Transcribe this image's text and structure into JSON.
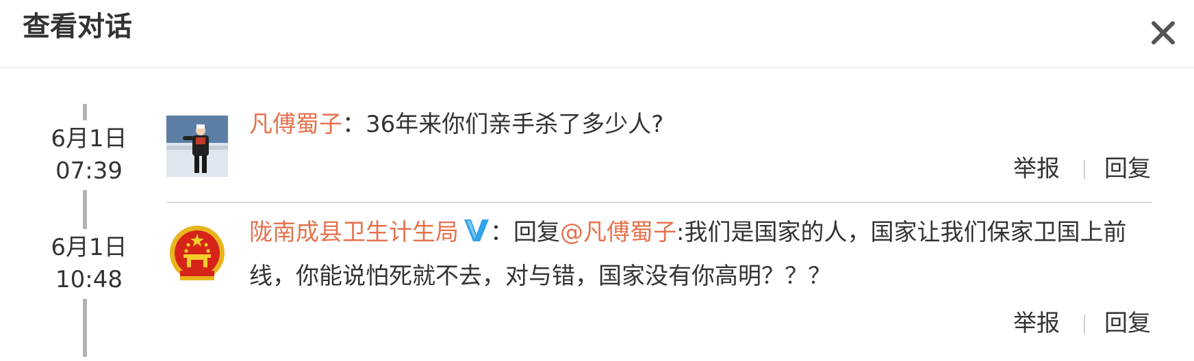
{
  "dialog": {
    "title": "查看对话",
    "close_icon": "close-icon"
  },
  "conversation": [
    {
      "date": "6月1日",
      "time": "07:39",
      "avatar": "user-photo-avatar",
      "user": "凡傅蜀子",
      "colon": "：",
      "text": "36年来你们亲手杀了多少人?",
      "actions": {
        "report": "举报",
        "reply": "回复"
      }
    },
    {
      "date": "6月1日",
      "time": "10:48",
      "avatar": "national-emblem-avatar",
      "user": "陇南成县卫生计生局",
      "verified_icon": "verified-v-icon",
      "colon": "：",
      "reply_prefix": "回复",
      "mention": "@凡傅蜀子",
      "text": ":我们是国家的人，国家让我们保家卫国上前线，你能说怕死就不去，对与错，国家没有你高明？？？",
      "actions": {
        "report": "举报",
        "reply": "回复"
      }
    }
  ],
  "colors": {
    "username": "#e5724e",
    "verified": "#2ea3e8",
    "text": "#333333",
    "timeline": "#b3b3b3"
  }
}
